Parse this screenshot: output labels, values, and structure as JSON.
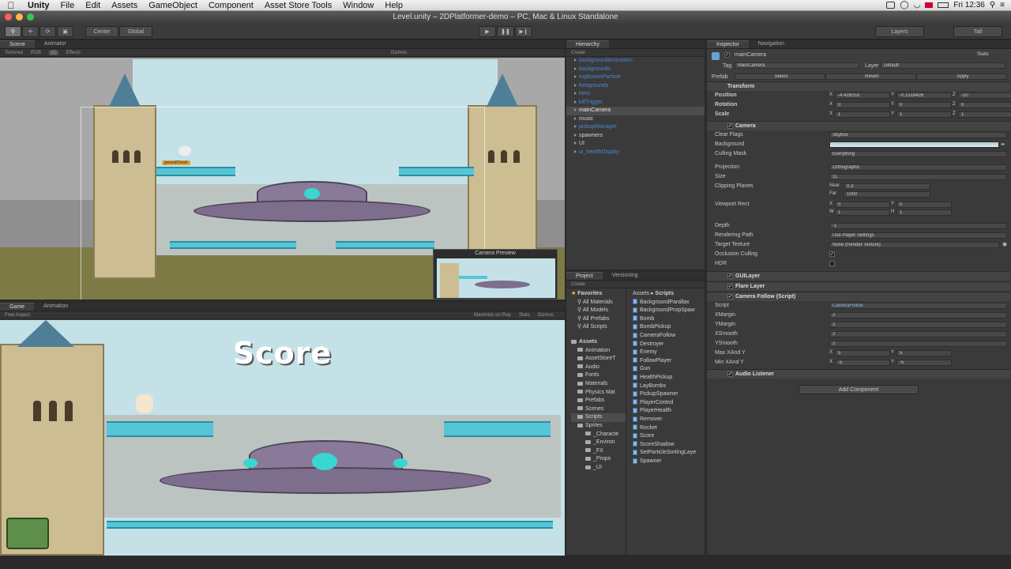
{
  "menubar": {
    "app": "Unity",
    "items": [
      "File",
      "Edit",
      "Assets",
      "GameObject",
      "Component",
      "Asset Store Tools",
      "Window",
      "Help"
    ],
    "clock": "Fri 12:36"
  },
  "window": {
    "title": "Level.unity – 2DPlatformer-demo – PC, Mac & Linux Standalone"
  },
  "toolbar": {
    "pivot": "Center",
    "space": "Global",
    "layers": "Layers",
    "layout": "Tall"
  },
  "scene": {
    "tabs": [
      "Scene",
      "Animator"
    ],
    "sub": [
      "Textured",
      "RGB",
      "2D",
      "Effects",
      "Gizmos"
    ],
    "label_ground": "groundCheck",
    "preview_title": "Camera Preview"
  },
  "game": {
    "tabs": [
      "Game",
      "Animation"
    ],
    "aspect": "Free Aspect",
    "maximize": "Maximize on Play",
    "stats": "Stats",
    "gizmos": "Gizmos",
    "score": "Score"
  },
  "hierarchy": {
    "tab": "Hierarchy",
    "create": "Create",
    "items": [
      {
        "name": "backgroundAnimation",
        "prefab": true
      },
      {
        "name": "backgrounds",
        "prefab": true
      },
      {
        "name": "explosionParticle",
        "prefab": true
      },
      {
        "name": "foregrounds",
        "prefab": true
      },
      {
        "name": "hero",
        "prefab": true
      },
      {
        "name": "killTrigger",
        "prefab": true
      },
      {
        "name": "mainCamera",
        "prefab": true,
        "selected": true
      },
      {
        "name": "music",
        "prefab": false
      },
      {
        "name": "pickupManager",
        "prefab": true
      },
      {
        "name": "spawners",
        "prefab": false
      },
      {
        "name": "UI",
        "prefab": false
      },
      {
        "name": "ui_healthDisplay",
        "prefab": true
      }
    ]
  },
  "project": {
    "tabs": [
      "Project",
      "Versioning"
    ],
    "create": "Create",
    "favorites": {
      "label": "Favorites",
      "items": [
        "All Materials",
        "All Models",
        "All Prefabs",
        "All Scripts"
      ]
    },
    "assets": {
      "label": "Assets",
      "items": [
        "Animation",
        "AssetStoreT",
        "Audio",
        "Fonts",
        "Materials",
        "Physics Mat",
        "Prefabs",
        "Scenes",
        "Scripts",
        "Sprites"
      ],
      "sprites": [
        "_Characte",
        "_Environ",
        "_FX",
        "_Props",
        "_UI"
      ]
    },
    "breadcrumb": [
      "Assets",
      "Scripts"
    ],
    "scripts": [
      "BackgroundParallax",
      "BackgroundPropSpaw",
      "Bomb",
      "BombPickup",
      "CameraFollow",
      "Destroyer",
      "Enemy",
      "FollowPlayer",
      "Gun",
      "HealthPickup",
      "LayBombs",
      "PickupSpawner",
      "PlayerControl",
      "PlayerHealth",
      "Remover",
      "Rocket",
      "Score",
      "ScoreShadow",
      "SetParticleSortingLaye",
      "Spawner"
    ]
  },
  "inspector": {
    "tabs": [
      "Inspector",
      "Navigation"
    ],
    "object": "mainCamera",
    "static": "Static",
    "tag_label": "Tag",
    "tag": "MainCamera",
    "layer_label": "Layer",
    "layer": "Default",
    "prefab_label": "Prefab",
    "prefab_buttons": [
      "Select",
      "Revert",
      "Apply"
    ],
    "transform": {
      "title": "Transform",
      "rows": [
        {
          "label": "Position",
          "x": "-4.428253",
          "y": "-0.1518426",
          "z": "-10"
        },
        {
          "label": "Rotation",
          "x": "0",
          "y": "0",
          "z": "0"
        },
        {
          "label": "Scale",
          "x": "1",
          "y": "1",
          "z": "1"
        }
      ]
    },
    "camera": {
      "title": "Camera",
      "clear_flags_label": "Clear Flags",
      "clear_flags": "Skybox",
      "background_label": "Background",
      "culling_label": "Culling Mask",
      "culling": "Everything",
      "projection_label": "Projection",
      "projection": "Orthographic",
      "size_label": "Size",
      "size": "11",
      "clipping_label": "Clipping Planes",
      "near": "0.3",
      "far": "1000",
      "near_label": "Near",
      "far_label": "Far",
      "viewport_label": "Viewport Rect",
      "vx": "0",
      "vy": "0",
      "vw": "1",
      "vh": "1",
      "depth_label": "Depth",
      "depth": "-1",
      "render_path_label": "Rendering Path",
      "render_path": "Use Player Settings",
      "target_label": "Target Texture",
      "target": "None (Render Texture)",
      "occlusion_label": "Occlusion Culling",
      "hdr_label": "HDR"
    },
    "gui_layer": "GUILayer",
    "flare_layer": "Flare Layer",
    "follow": {
      "title": "Camera Follow (Script)",
      "script_label": "Script",
      "script": "CameraFollow",
      "rows": [
        {
          "label": "XMargin",
          "value": "2"
        },
        {
          "label": "YMargin",
          "value": "2"
        },
        {
          "label": "XSmooth",
          "value": "2"
        },
        {
          "label": "YSmooth",
          "value": "2"
        }
      ],
      "max_label": "Max XAnd Y",
      "max_x": "5",
      "max_y": "5",
      "min_label": "Min XAnd Y",
      "min_x": "-5",
      "min_y": "-5"
    },
    "audio": "Audio Listener",
    "add_component": "Add Component"
  },
  "colors": {
    "link": "#4a88d2",
    "bg": "#3a3a3a",
    "sky": "#c4e1e8",
    "cyan": "#39d7d0"
  }
}
